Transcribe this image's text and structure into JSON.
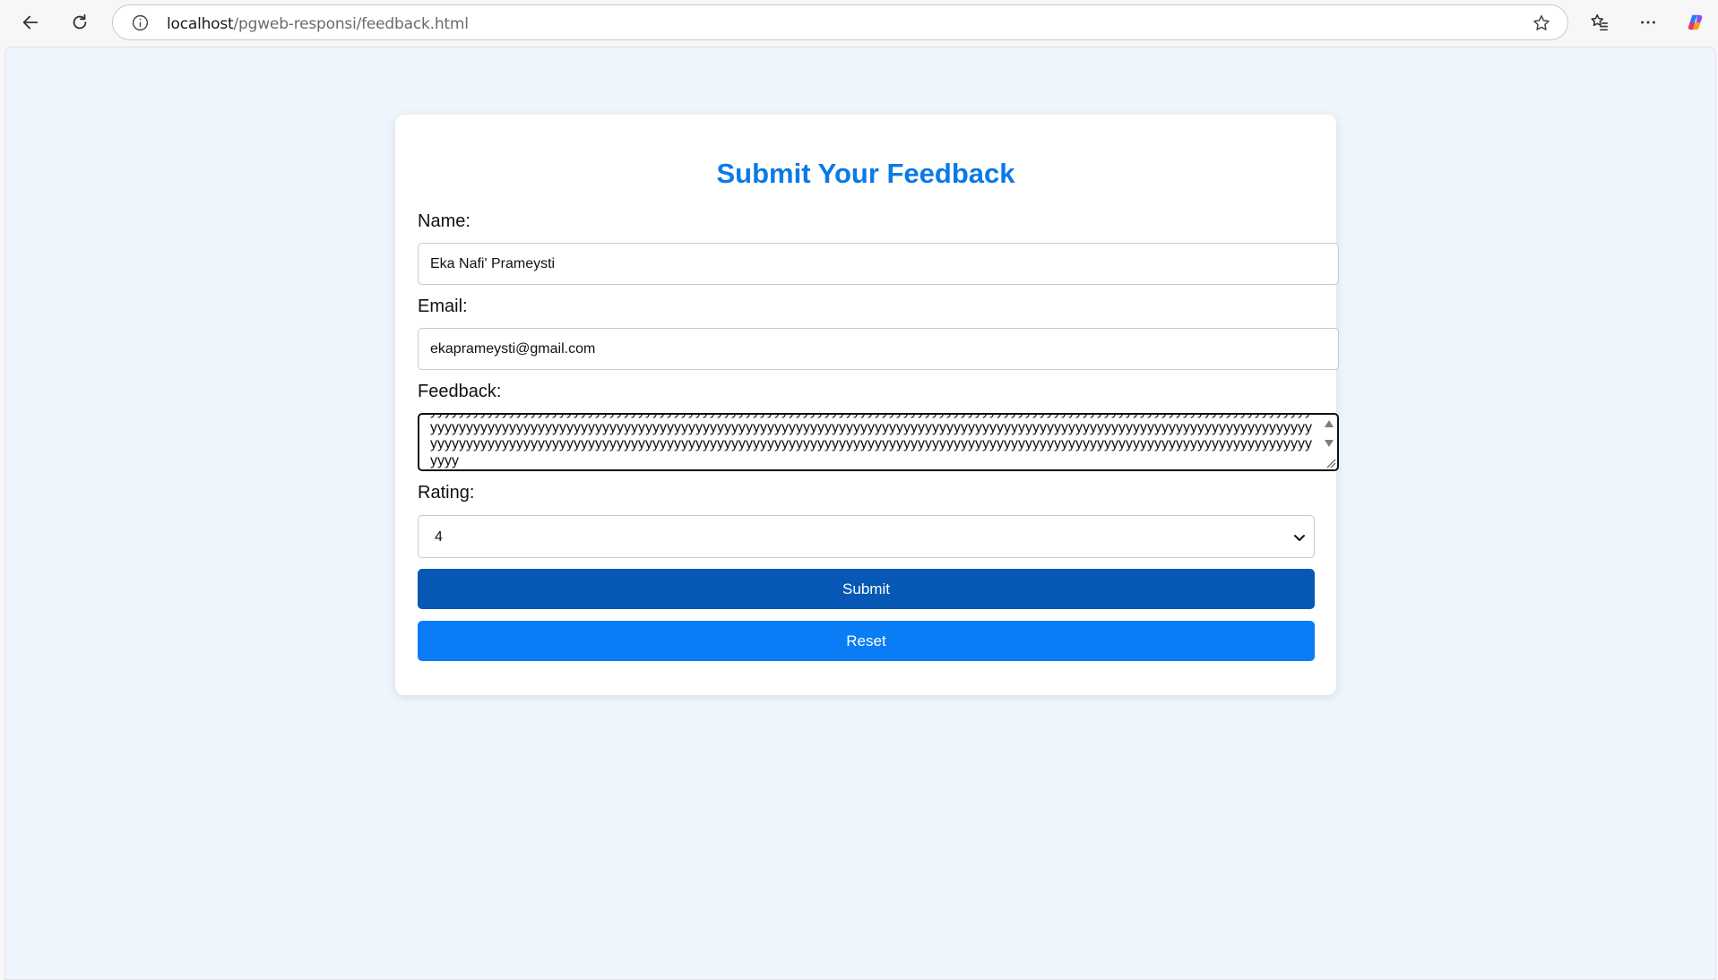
{
  "browser": {
    "url_host": "localhost",
    "url_path": "/pgweb-responsi/feedback.html"
  },
  "form": {
    "title": "Submit Your Feedback",
    "name_label": "Name:",
    "name_value": "Eka Nafi' Prameysti",
    "email_label": "Email:",
    "email_value": "ekaprameysti@gmail.com",
    "feedback_label": "Feedback:",
    "feedback_value": "yyyyyyyyyyyyyyyyyyyyyyyyyyyyyyyyyyyyyyyyyyyyyyyyyyyyyyyyyyyyyyyyyyyyyyyyyyyyyyyyyyyyyyyyyyyyyyyyyyyyyyyyyyyyyyyyyyyyyyyyyyyyyyyyyyyyyyyyyyyyyyyyyyyyyyyyyyyyyyyyyyyyyyyyyyyyyyyyyyyyyyyyyyyyyyyyyyyyyyyyyyyyyyyyyyyyyyyyyyyyyyyyyyyyyyyyyyyyyyyyyyyyyyyyyyyyyyyyyyyyyyyyyyyyyyyyyyyyyyyyyyyyyyyyyyyyyyyyyyyyyyyyyyyyyyyyyyyyyyyyyyyyyyyyyyyyyyyyyyyyyyyyyyyyyyyyyyyyyyyyyyyyyyyyyyyyy",
    "rating_label": "Rating:",
    "rating_value": "4",
    "submit_label": "Submit",
    "reset_label": "Reset"
  },
  "colors": {
    "title": "#0a7ae6",
    "submit_button": "#0658b4",
    "reset_button": "#0a7cf5",
    "page_background": "#eef5fc"
  }
}
